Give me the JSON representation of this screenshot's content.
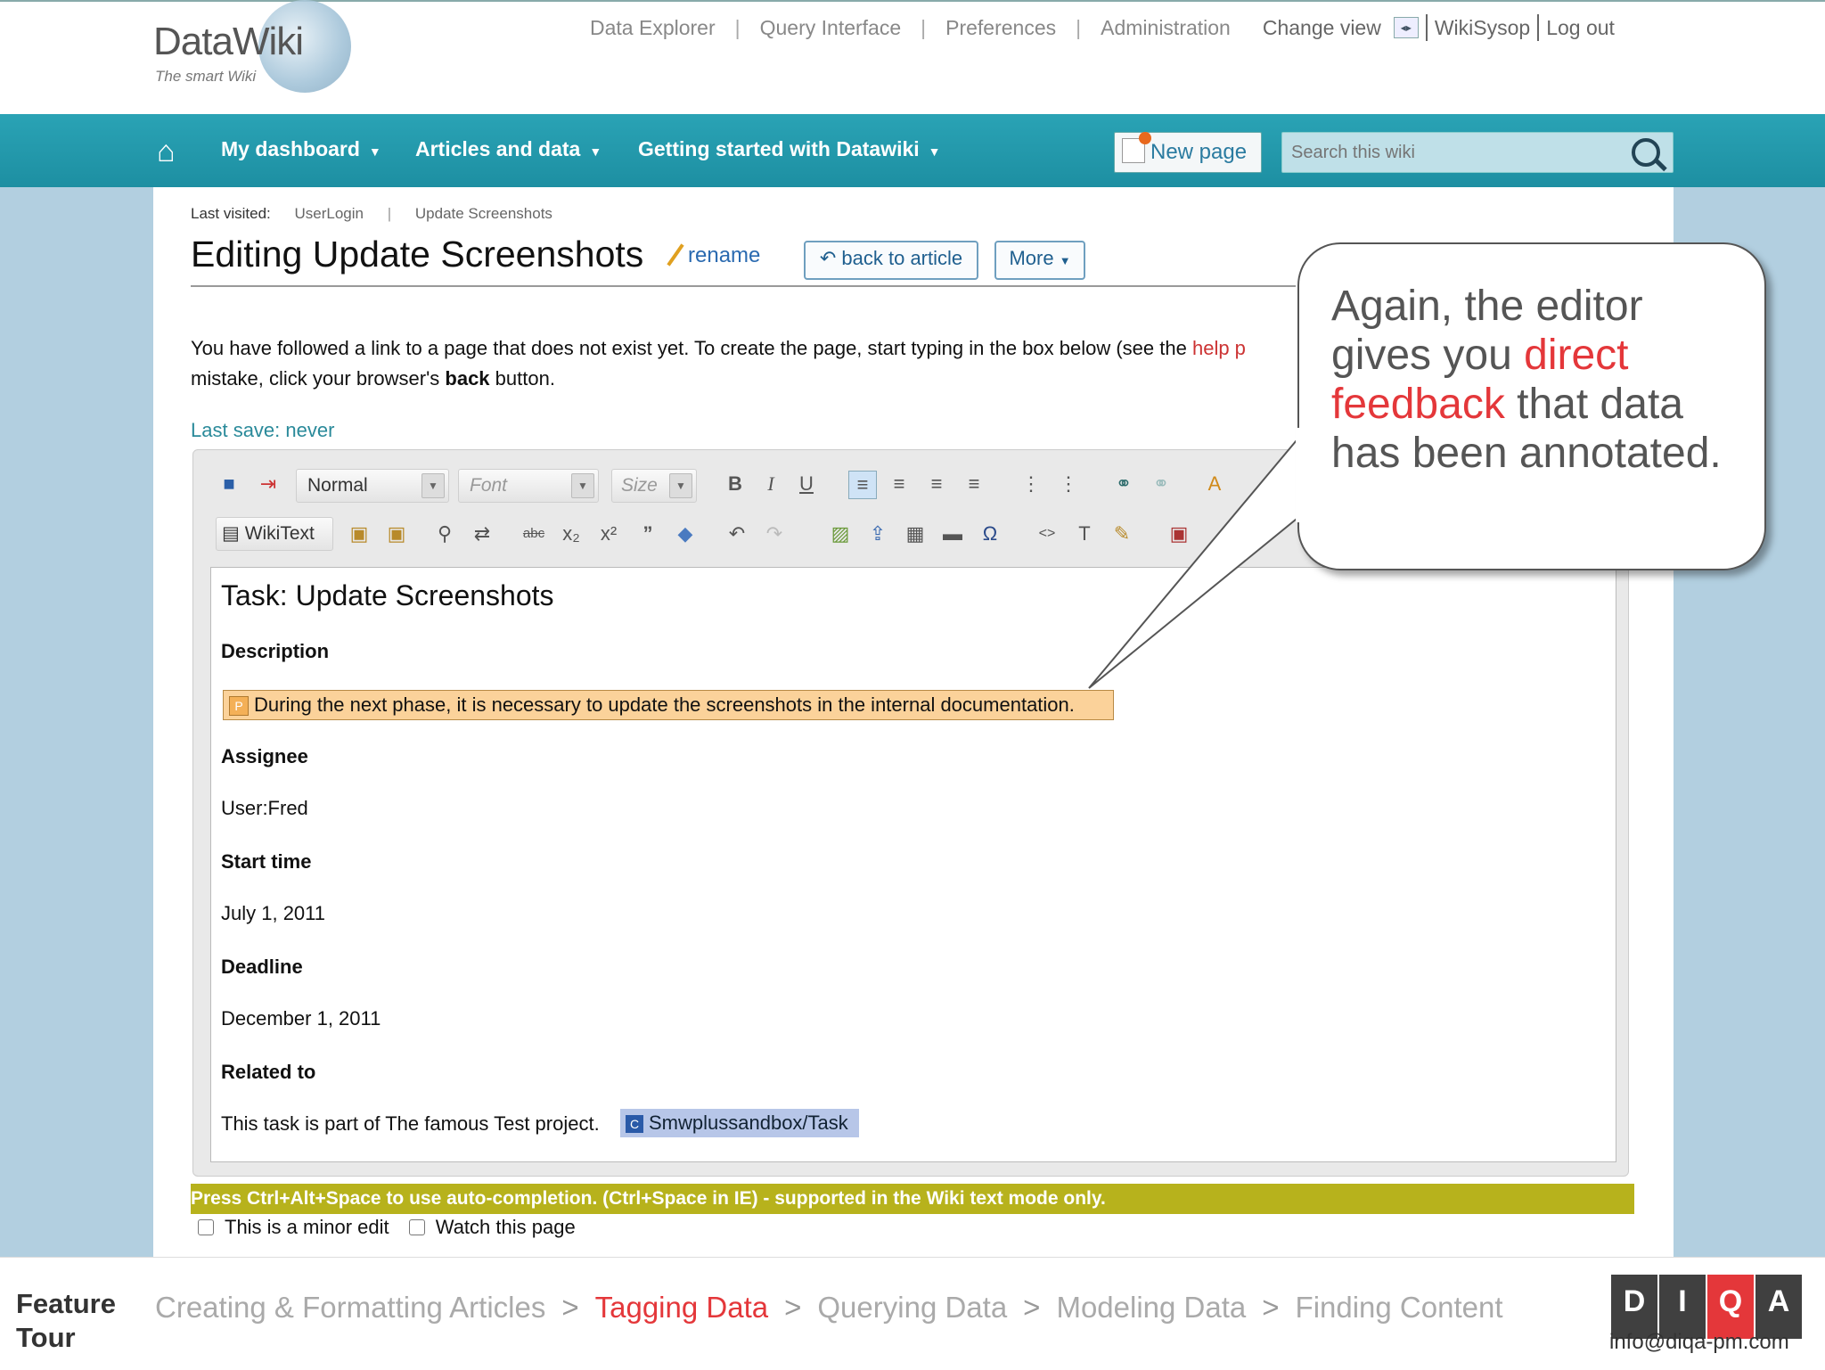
{
  "header": {
    "logo_title": "DataWiki",
    "logo_tagline": "The smart Wiki",
    "top_links": [
      "Data Explorer",
      "Query Interface",
      "Preferences",
      "Administration"
    ],
    "change_view": "Change view",
    "user": "WikiSysop",
    "logout": "Log out"
  },
  "navbar": {
    "items": [
      "My dashboard",
      "Articles and data",
      "Getting started with Datawiki"
    ],
    "new_page": "New page",
    "search_placeholder": "Search this wiki"
  },
  "page": {
    "last_visited_label": "Last visited:",
    "last_visited": [
      "UserLogin",
      "Update Screenshots"
    ],
    "title": "Editing Update Screenshots",
    "rename": "rename",
    "back": "back to article",
    "more": "More",
    "intro_1": "You have followed a link to a page that does not exist yet. To create the page, start typing in the box below (see the ",
    "intro_link": "help p",
    "intro_2": "mistake, click your browser's ",
    "intro_bold": "back",
    "intro_3": " button.",
    "last_save": "Last save: never"
  },
  "toolbar": {
    "format": "Normal",
    "font": "Font",
    "size": "Size",
    "wikitext": "WikiText"
  },
  "editor": {
    "doc_title": "Task: Update Screenshots",
    "fields": [
      {
        "label": "Description"
      },
      {
        "label": "Assignee",
        "value": "User:Fred"
      },
      {
        "label": "Start time",
        "value": "July 1, 2011"
      },
      {
        "label": "Deadline",
        "value": "December 1, 2011"
      },
      {
        "label": "Related to",
        "value": "This task is part of The famous Test project."
      }
    ],
    "description": "During the next phase, it is necessary to update the screenshots in the internal documentation.",
    "category": "Smwplussandbox/Task",
    "annot_p": "P",
    "annot_c": "C"
  },
  "hint": "Press Ctrl+Alt+Space to use auto-completion. (Ctrl+Space in IE) - supported in the Wiki text mode only.",
  "options": {
    "minor": "This is a minor edit",
    "watch": "Watch this page"
  },
  "callout": {
    "text_1": "Again, the editor gives you ",
    "text_red": "direct feedback",
    "text_2": " that data has been annotated."
  },
  "footer": {
    "label_1": "Feature",
    "label_2": "Tour",
    "crumbs": [
      "Creating & Formatting Articles",
      "Tagging Data",
      "Querying Data",
      "Modeling Data",
      "Finding Content"
    ],
    "active_crumb": 1,
    "brand_letters": [
      "D",
      "I",
      "Q",
      "A"
    ],
    "email": "info@diqa-pm.com"
  },
  "colors": {
    "accent_red": "#e4373a",
    "teal": "#1d8fa2",
    "hint_bar": "#b7b21c"
  }
}
